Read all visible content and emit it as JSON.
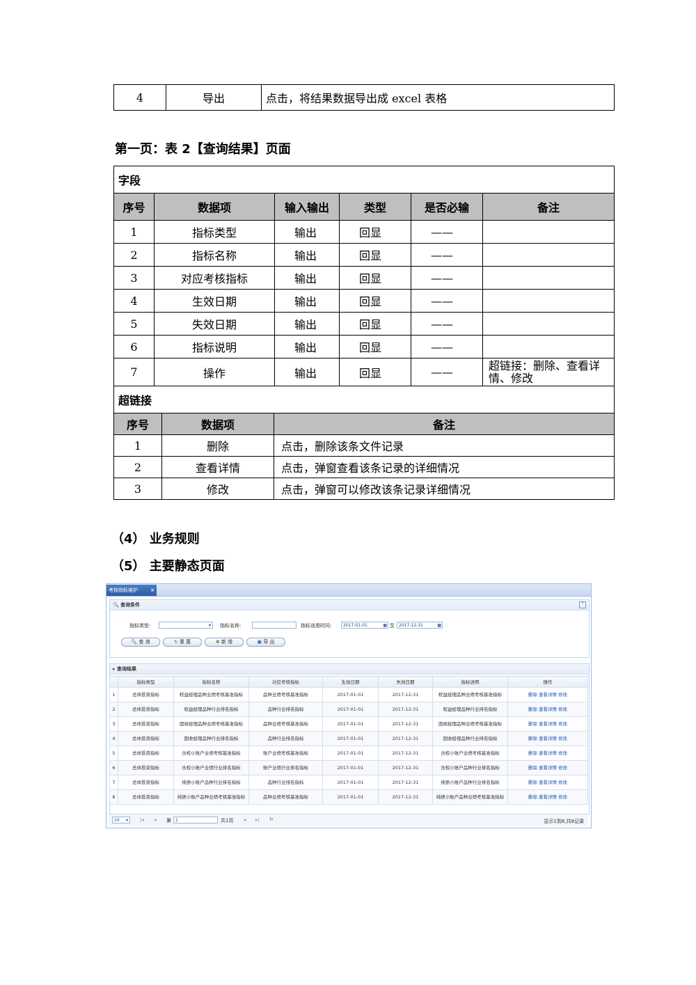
{
  "top_table": {
    "no": "4",
    "item": "导出",
    "remark": "点击，将结果数据导出成 excel 表格"
  },
  "heading1": "第一页：表 2【查询结果】页面",
  "main_table": {
    "section_fields": "字段",
    "headers": [
      "序号",
      "数据项",
      "输入输出",
      "类型",
      "是否必输",
      "备注"
    ],
    "rows": [
      {
        "no": "1",
        "item": "指标类型",
        "io": "输出",
        "type": "回显",
        "req": "——",
        "remark": ""
      },
      {
        "no": "2",
        "item": "指标名称",
        "io": "输出",
        "type": "回显",
        "req": "——",
        "remark": ""
      },
      {
        "no": "3",
        "item": "对应考核指标",
        "io": "输出",
        "type": "回显",
        "req": "——",
        "remark": ""
      },
      {
        "no": "4",
        "item": "生效日期",
        "io": "输出",
        "type": "回显",
        "req": "——",
        "remark": ""
      },
      {
        "no": "5",
        "item": "失效日期",
        "io": "输出",
        "type": "回显",
        "req": "——",
        "remark": ""
      },
      {
        "no": "6",
        "item": "指标说明",
        "io": "输出",
        "type": "回显",
        "req": "——",
        "remark": ""
      },
      {
        "no": "7",
        "item": "操作",
        "io": "输出",
        "type": "回显",
        "req": "——",
        "remark": "超链接：删除、查看详情、修改"
      }
    ],
    "section_links": "超链接",
    "link_headers": [
      "序号",
      "数据项",
      "备注"
    ],
    "link_rows": [
      {
        "no": "1",
        "item": "删除",
        "remark": "点击，删除该条文件记录"
      },
      {
        "no": "2",
        "item": "查看详情",
        "remark": "点击，弹窗查看该条记录的详细情况"
      },
      {
        "no": "3",
        "item": "修改",
        "remark": "点击，弹窗可以修改该条记录详细情况"
      }
    ]
  },
  "heading2": "（4） 业务规则",
  "heading3": "（5） 主要静态页面",
  "screenshot": {
    "tab_title": "考核指标维护",
    "query_panel_title": "查询条件",
    "label_type": "指标类型:",
    "label_name": "指标名称:",
    "label_time": "指标适用时间:",
    "date_from": "2017-01-01",
    "date_to": "2017-12-31",
    "to_label": "至",
    "btn_query": "查 询",
    "btn_reset": "重 置",
    "btn_add": "新 增",
    "btn_export": "导 出",
    "result_panel_title": "查询结果",
    "grid_headers": [
      "",
      "指标类型",
      "指标名称",
      "对应考核指标",
      "生效日期",
      "失效日期",
      "指标说明",
      "操作"
    ],
    "grid_rows": [
      {
        "n": "1",
        "type": "总体投资指标",
        "name": "权益经理品种业绩考核基准指标",
        "kpi": "品种业绩考核基准指标",
        "start": "2017-01-01",
        "end": "2017-12-31",
        "desc": "权益经理品种业绩考核基准指标"
      },
      {
        "n": "2",
        "type": "总体投资指标",
        "name": "权益经理品种行业排名指标",
        "kpi": "品种行业排名指标",
        "start": "2017-01-01",
        "end": "2017-12-31",
        "desc": "权益经理品种行业排名指标"
      },
      {
        "n": "3",
        "type": "总体投资指标",
        "name": "固收经理品种业绩考核基准指标",
        "kpi": "品种业绩考核基准指标",
        "start": "2017-01-01",
        "end": "2017-12-31",
        "desc": "固收经理品种业绩考核基准指标"
      },
      {
        "n": "4",
        "type": "总体投资指标",
        "name": "固收经理品种行业排名指标",
        "kpi": "品种行业排名指标",
        "start": "2017-01-01",
        "end": "2017-12-31",
        "desc": "固收经理品种行业排名指标"
      },
      {
        "n": "5",
        "type": "总体投资指标",
        "name": "含权小账户业绩考核基准指标",
        "kpi": "账户业绩考核基准指标",
        "start": "2017-01-01",
        "end": "2017-12-31",
        "desc": "含权小账户业绩考核基准指标"
      },
      {
        "n": "6",
        "type": "总体投资指标",
        "name": "含权小账户业绩行业排名指标",
        "kpi": "账户业绩行业排名指标",
        "start": "2017-01-01",
        "end": "2017-12-31",
        "desc": "含权小账户品种行业排名指标"
      },
      {
        "n": "7",
        "type": "总体投资指标",
        "name": "纯债小账户品种行业排名指标",
        "kpi": "品种行业排名指标",
        "start": "2017-01-01",
        "end": "2017-12-31",
        "desc": "纯债小账户品种行业排名指标"
      },
      {
        "n": "8",
        "type": "总体投资指标",
        "name": "纯债小账户品种业绩考核基准指标",
        "kpi": "品种业绩考核基准指标",
        "start": "2017-01-01",
        "end": "2017-12-31",
        "desc": "纯债小账户品种业绩考核基准指标"
      }
    ],
    "op_delete": "删除",
    "op_view": "查看详情",
    "op_edit": "修改",
    "page_size": "10",
    "page_label": "第",
    "page_value": "1",
    "page_total": "共1页",
    "record_info": "显示1到8,共8记录"
  }
}
